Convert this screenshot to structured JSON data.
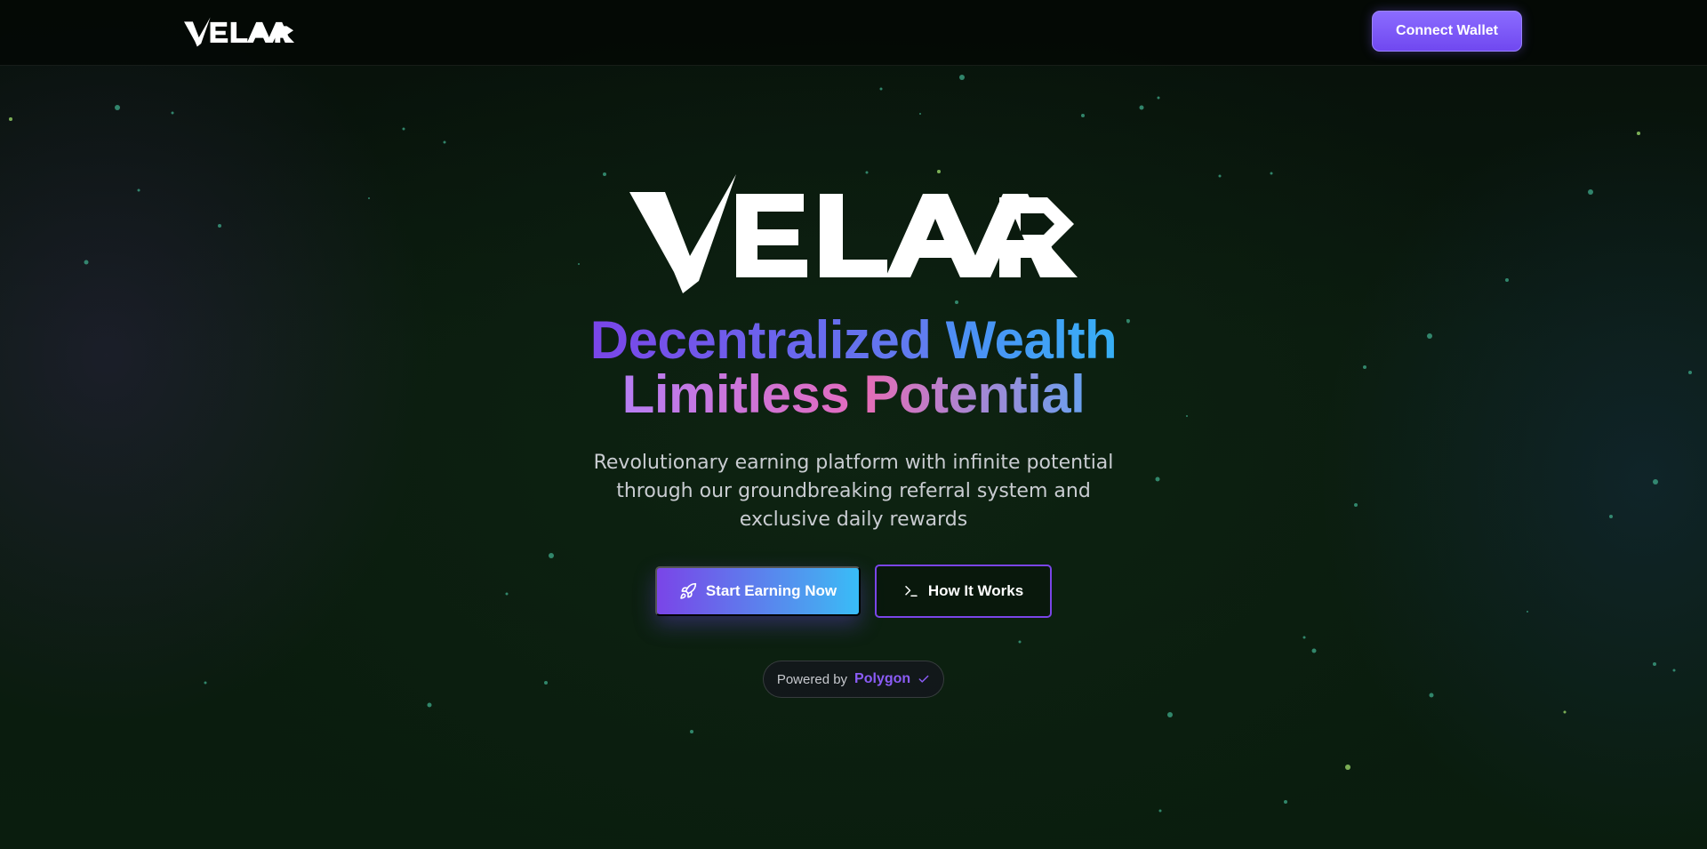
{
  "header": {
    "logo_text": "VELAAR",
    "connect_label": "Connect Wallet"
  },
  "hero": {
    "logo_text": "VELAAR",
    "headline": {
      "line1_word1": "Decentralized",
      "line1_word2": "Wealth",
      "line2_word1": "Limitless",
      "line2_word2": "Potential"
    },
    "subtitle": "Revolutionary earning platform with infinite potential through our groundbreaking referral system and exclusive daily rewards",
    "primary_cta": {
      "label": "Start Earning Now",
      "icon": "rocket-icon"
    },
    "secondary_cta": {
      "label": "How It Works",
      "icon": "terminal-icon"
    },
    "powered": {
      "label": "Powered by",
      "brand": "Polygon",
      "icon": "check-icon"
    }
  },
  "colors": {
    "accent_purple": "#7a45e8",
    "accent_blue": "#38bdf8",
    "accent_pink": "#e06cc0",
    "background": "#0a1a0e"
  }
}
